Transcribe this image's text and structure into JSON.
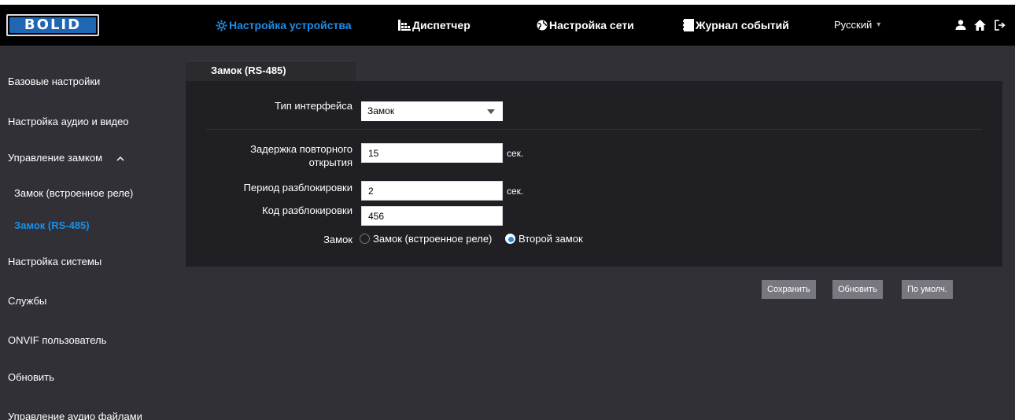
{
  "brand": {
    "logo_text": "BOLID"
  },
  "nav": {
    "device_settings": "Настройка устройства",
    "dispatcher": "Диспетчер",
    "network_settings": "Настройка сети",
    "event_log": "Журнал событий",
    "language": "Русский"
  },
  "sidebar": {
    "items": [
      {
        "label": "Базовые настройки"
      },
      {
        "label": "Настройка аудио и видео"
      },
      {
        "label": "Управление замком"
      },
      {
        "label": "Замок (встроенное реле)"
      },
      {
        "label": "Замок (RS-485)"
      },
      {
        "label": "Настройка системы"
      },
      {
        "label": "Службы"
      },
      {
        "label": "ONVIF пользователь"
      },
      {
        "label": "Обновить"
      },
      {
        "label": "Управление аудио файлами"
      }
    ]
  },
  "tab": {
    "label": "Замок (RS-485)"
  },
  "form": {
    "interface_type_label": "Тип интерфейса",
    "interface_type_value": "Замок",
    "reopen_delay_label_1": "Задержка повторного",
    "reopen_delay_label_2": "открытия",
    "reopen_delay_value": "15",
    "reopen_delay_unit": "сек.",
    "unlock_period_label": "Период разблокировки",
    "unlock_period_value": "2",
    "unlock_period_unit": "сек.",
    "unlock_code_label": "Код разблокировки",
    "unlock_code_value": "456",
    "lock_label": "Замок",
    "lock_option_builtin": "Замок (встроенное реле)",
    "lock_option_second": "Второй замок",
    "lock_selected": "Второй замок"
  },
  "buttons": {
    "save": "Сохранить",
    "refresh": "Обновить",
    "default": "По умолч."
  },
  "colors": {
    "accent": "#1c8ee8",
    "background": "#303036",
    "panel": "#1f1f24",
    "topbar": "#000000",
    "button": "#787880"
  }
}
